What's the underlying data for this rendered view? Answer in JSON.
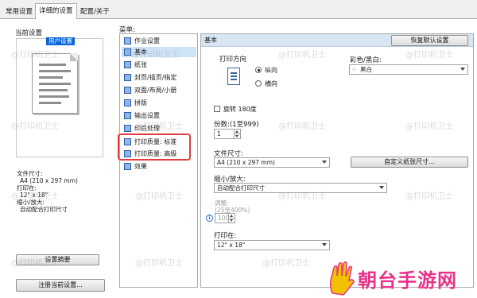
{
  "tabs": [
    {
      "label": "常用设置"
    },
    {
      "label": "详细的设置"
    },
    {
      "label": "配置/关于"
    }
  ],
  "left": {
    "current_settings_label": "当前设置",
    "selected_badge": "用户设置",
    "info": [
      "文件尺寸:",
      "A4 (210 x 297 mm)",
      "打印在:",
      "12\" x 18\"",
      "缩小/放大:",
      "自动配合打印尺寸"
    ],
    "settings_summary_button": "设置摘要",
    "register_button": "注册当前设置..."
  },
  "menu": {
    "label": "菜单:",
    "items": [
      {
        "label": "作业设置",
        "icon": "job-settings-icon"
      },
      {
        "label": "基本",
        "icon": "basic-icon"
      },
      {
        "label": "纸张",
        "icon": "paper-icon"
      },
      {
        "label": "封页/插页/指定",
        "icon": "cover-insert-icon"
      },
      {
        "label": "双面/布局/小册",
        "icon": "duplex-layout-icon"
      },
      {
        "label": "拼版",
        "icon": "imposition-icon"
      },
      {
        "label": "输出设置",
        "icon": "output-icon"
      },
      {
        "label": "印后处理",
        "icon": "finishing-icon"
      },
      {
        "label": "打印质量: 标准",
        "icon": "print-quality-standard-icon"
      },
      {
        "label": "打印质量: 高级",
        "icon": "print-quality-advanced-icon"
      },
      {
        "label": "效果",
        "icon": "effects-icon"
      }
    ]
  },
  "content": {
    "section_title": "基本",
    "restore_defaults_button": "恢复默认设置",
    "orientation_label": "打印方向",
    "orientation_options": [
      "纵向",
      "横向"
    ],
    "color_label": "彩色/黑白:",
    "color_value": "黑白",
    "rotate_label": "旋转 180度",
    "copies_label": "份数:(1至999)",
    "copies_value": "1",
    "document_size_label": "文件尺寸:",
    "document_size_value": "A4 (210 x 297 mm)",
    "custom_paper_button": "自定义纸张尺寸...",
    "scale_label": "缩小/放大:",
    "scale_value": "自动配合打印尺寸",
    "zoom_label": "调整:",
    "zoom_range": "(25至400%)",
    "zoom_value": "100",
    "print_on_label": "打印在:",
    "print_on_value": "12\" x 18\""
  },
  "watermark_text": "@打印机卫士",
  "brand_text": "朝台手游网",
  "colors": {
    "highlight": "#e23b3b",
    "header_bar": "#d8e6f3",
    "menu_selected": "#cfe3f7",
    "brand": "#e8338a"
  }
}
